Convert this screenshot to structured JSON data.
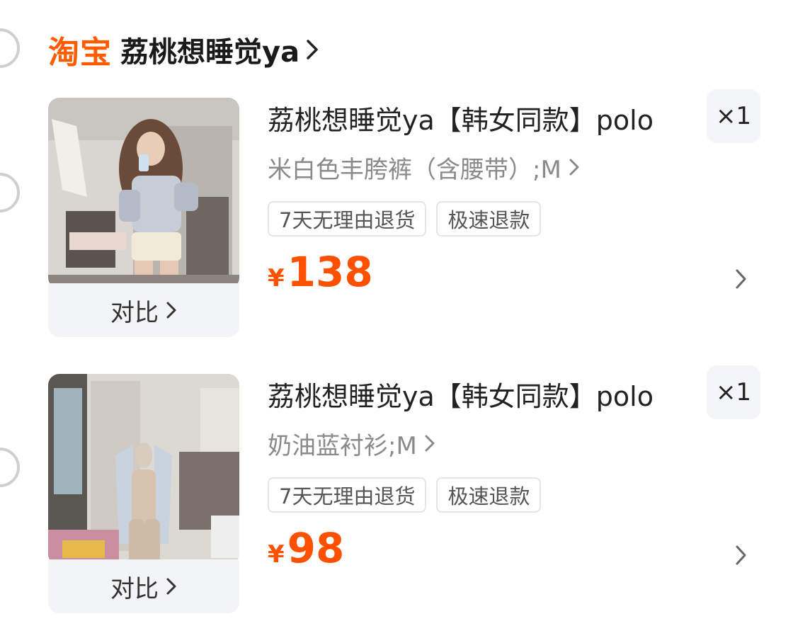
{
  "shop": {
    "logo_text": "淘宝",
    "name": "荔桃想睡觉ya",
    "brand_color": "#ff5c00"
  },
  "items": [
    {
      "title": "荔桃想睡觉ya【韩女同款】polo",
      "quantity": "×1",
      "spec": "米白色丰胯裤（含腰带）;M",
      "tags": [
        "7天无理由退货",
        "极速退款"
      ],
      "currency": "¥",
      "price": "138",
      "compare_label": "对比"
    },
    {
      "title": "荔桃想睡觉ya【韩女同款】polo",
      "quantity": "×1",
      "spec": "奶油蓝衬衫;M",
      "tags": [
        "7天无理由退货",
        "极速退款"
      ],
      "currency": "¥",
      "price": "98",
      "compare_label": "对比"
    }
  ],
  "colors": {
    "price": "#ff5000",
    "muted_text": "#8a8a8a",
    "radio_border": "#cfcfcf"
  }
}
